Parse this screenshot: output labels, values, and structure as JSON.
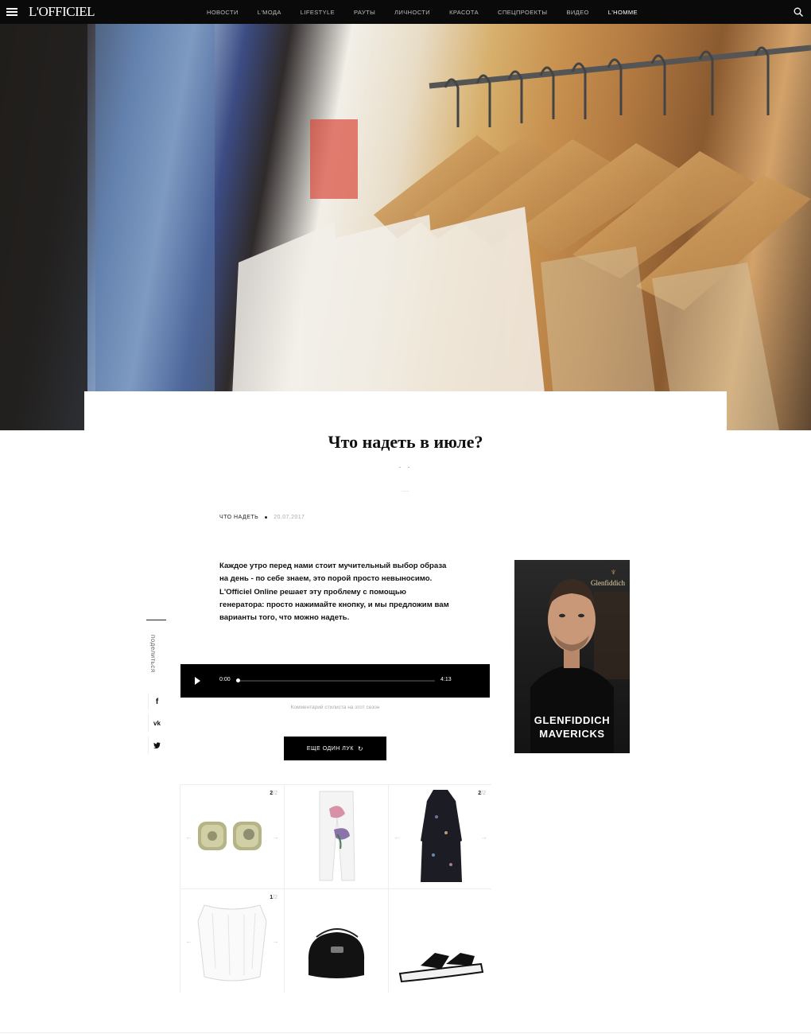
{
  "header": {
    "logo": "L'OFFICIEL",
    "nav": [
      "НОВОСТИ",
      "L'МОДА",
      "LIFESTYLE",
      "РАУТЫ",
      "ЛИЧНОСТИ",
      "КРАСОТА",
      "СПЕЦПРОЕКТЫ",
      "ВИДЕО",
      "L'HOMME"
    ],
    "active_nav": "L'HOMME"
  },
  "article": {
    "title": "Что надеть в июле?",
    "title_dots": ". .",
    "lead_hint": "·····",
    "category": "ЧТО НАДЕТЬ",
    "date": "20.07.2017",
    "intro": "Каждое утро перед нами стоит мучительный выбор образа на день - по себе знаем, это порой просто невыносимо. L'Officiel Online решает эту проблему с помощью генератора: просто нажимайте кнопку, и мы предложим вам варианты того, что можно надеть."
  },
  "share": {
    "label": "поделиться",
    "networks": [
      "f",
      "vk",
      "tw"
    ]
  },
  "audio": {
    "current": "0:00",
    "duration": "4:13",
    "progress": 0,
    "caption": "Комментарий стилиста на этот сезон"
  },
  "more_button": {
    "label": "ЕЩЕ ОДИН ЛУК",
    "icon": "refresh-icon"
  },
  "ad": {
    "brand": "Glenfiddich",
    "headline_1": "GLENFIDDICH",
    "headline_2": "MAVERICKS"
  },
  "products": [
    {
      "item": "earrings",
      "count": "2",
      "total": "/2"
    },
    {
      "item": "jeans",
      "count": "",
      "total": ""
    },
    {
      "item": "dress",
      "count": "2",
      "total": "/2"
    },
    {
      "item": "top",
      "count": "1",
      "total": "/2"
    },
    {
      "item": "bag",
      "count": "",
      "total": ""
    },
    {
      "item": "sandals",
      "count": "",
      "total": ""
    }
  ],
  "colors": {
    "nav_bg": "#0a0a0a",
    "button_bg": "#000000",
    "ad_bg": "#1e1e1e"
  }
}
